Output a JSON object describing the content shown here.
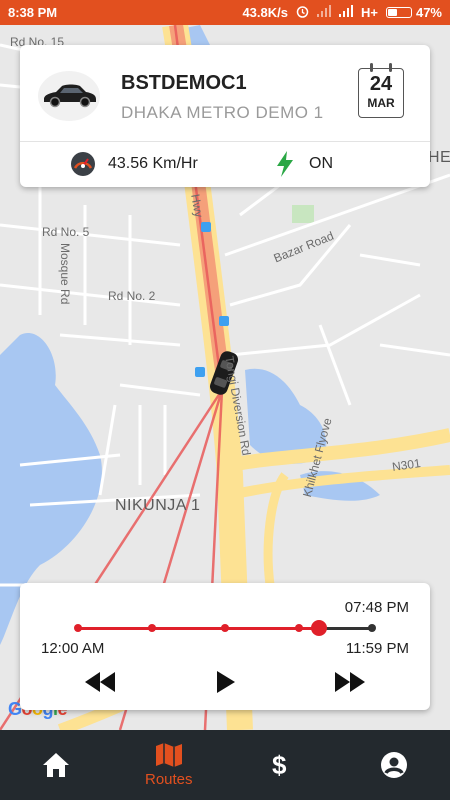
{
  "status_bar": {
    "time": "8:38 PM",
    "net_speed": "43.8K/s",
    "network": "H+",
    "battery_text": "47%",
    "battery_level": 0.47,
    "bg_color": "#e2501f"
  },
  "map": {
    "labels": {
      "rd_no_15": "Rd No. 15",
      "rd_no_5": "Rd No. 5",
      "rd_no_2": "Rd No. 2",
      "mosque_rd": "Mosque Rd",
      "bazar_road": "Bazar Road",
      "nikunja": "NIKUNJA 1",
      "n301": "N301",
      "khilkhet": "Khilkhet Flyove",
      "airport_rd": "Tongi Diversion Rd",
      "hwy": "Hwy",
      "edge_he": "HE"
    },
    "google_logo": "Google"
  },
  "vehicle": {
    "name": "BSTDEMOC1",
    "group": "DHAKA METRO DEMO 1",
    "date_day": "24",
    "date_month": "MAR",
    "speed": "43.56 Km/Hr",
    "ignition": "ON",
    "ignition_color": "#2aa745"
  },
  "playback": {
    "current_time": "07:48 PM",
    "start_time": "12:00 AM",
    "end_time": "11:59 PM",
    "progress": 0.82,
    "accent_color": "#e0202a"
  },
  "nav": {
    "items": [
      {
        "id": "home",
        "icon": "home-icon",
        "label": ""
      },
      {
        "id": "routes",
        "icon": "map-icon",
        "label": "Routes",
        "active": true
      },
      {
        "id": "billing",
        "icon": "dollar-icon",
        "label": ""
      },
      {
        "id": "profile",
        "icon": "account-icon",
        "label": ""
      }
    ],
    "active_color": "#e2501f",
    "bg_color": "#23292e"
  }
}
